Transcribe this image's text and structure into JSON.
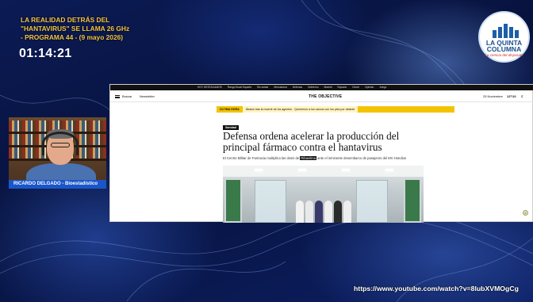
{
  "overlay": {
    "show_title_lines": [
      "LA REALIDAD DETRÁS DEL",
      "\"HANTAVIRUS\" SE LLAMA 26 GHz",
      "- PROGRAMA 44 - (9 mayo 2026)"
    ],
    "timer": "01:14:21",
    "presenter_name": "RICARDO DELGADO - Bioestadístico",
    "video_url": "https://www.youtube.com/watch?v=8lubXVMOgCg"
  },
  "logo": {
    "line1": "LA QUINTA",
    "line2": "COLUMNA",
    "tagline": "La ciencia del disparate"
  },
  "browser": {
    "topbar_items": [
      "HOY DESTACAMOS",
      "Rango fiscal España",
      "Sin avisar",
      "Mercadona",
      "Defensa",
      "Gobierno",
      "Madrid",
      "Espacio",
      "Cierre",
      "Opinión",
      "Juego"
    ],
    "nav": {
      "search_label": "Buscar",
      "newsletter_label": "Newsletter",
      "site_name": "THE OBJECTIVE",
      "date": "25 Noviembre",
      "weather": "13°/10",
      "mode": "☾"
    },
    "breaking": {
      "label": "ÚLTIMA HORA",
      "text": "Ábalos tras la muerte de los agentes · Queremos a los narcos con los pies por delante"
    },
    "article": {
      "section": "Sanidad",
      "headline": "Defensa ordena acelerar la producción del principal fármaco contra el hantavirus",
      "lead_before": "El Centro Militar de Farmacia multiplica las dosis de",
      "lead_highlight": "Ribavirina",
      "lead_after": "ante el inminente desembarco de pasajeros del MV Hondius"
    },
    "side_badge": "8"
  },
  "colors": {
    "title_yellow": "#f5c542",
    "name_plate_blue": "#1a56c9",
    "breaking_yellow": "#f2c300"
  }
}
